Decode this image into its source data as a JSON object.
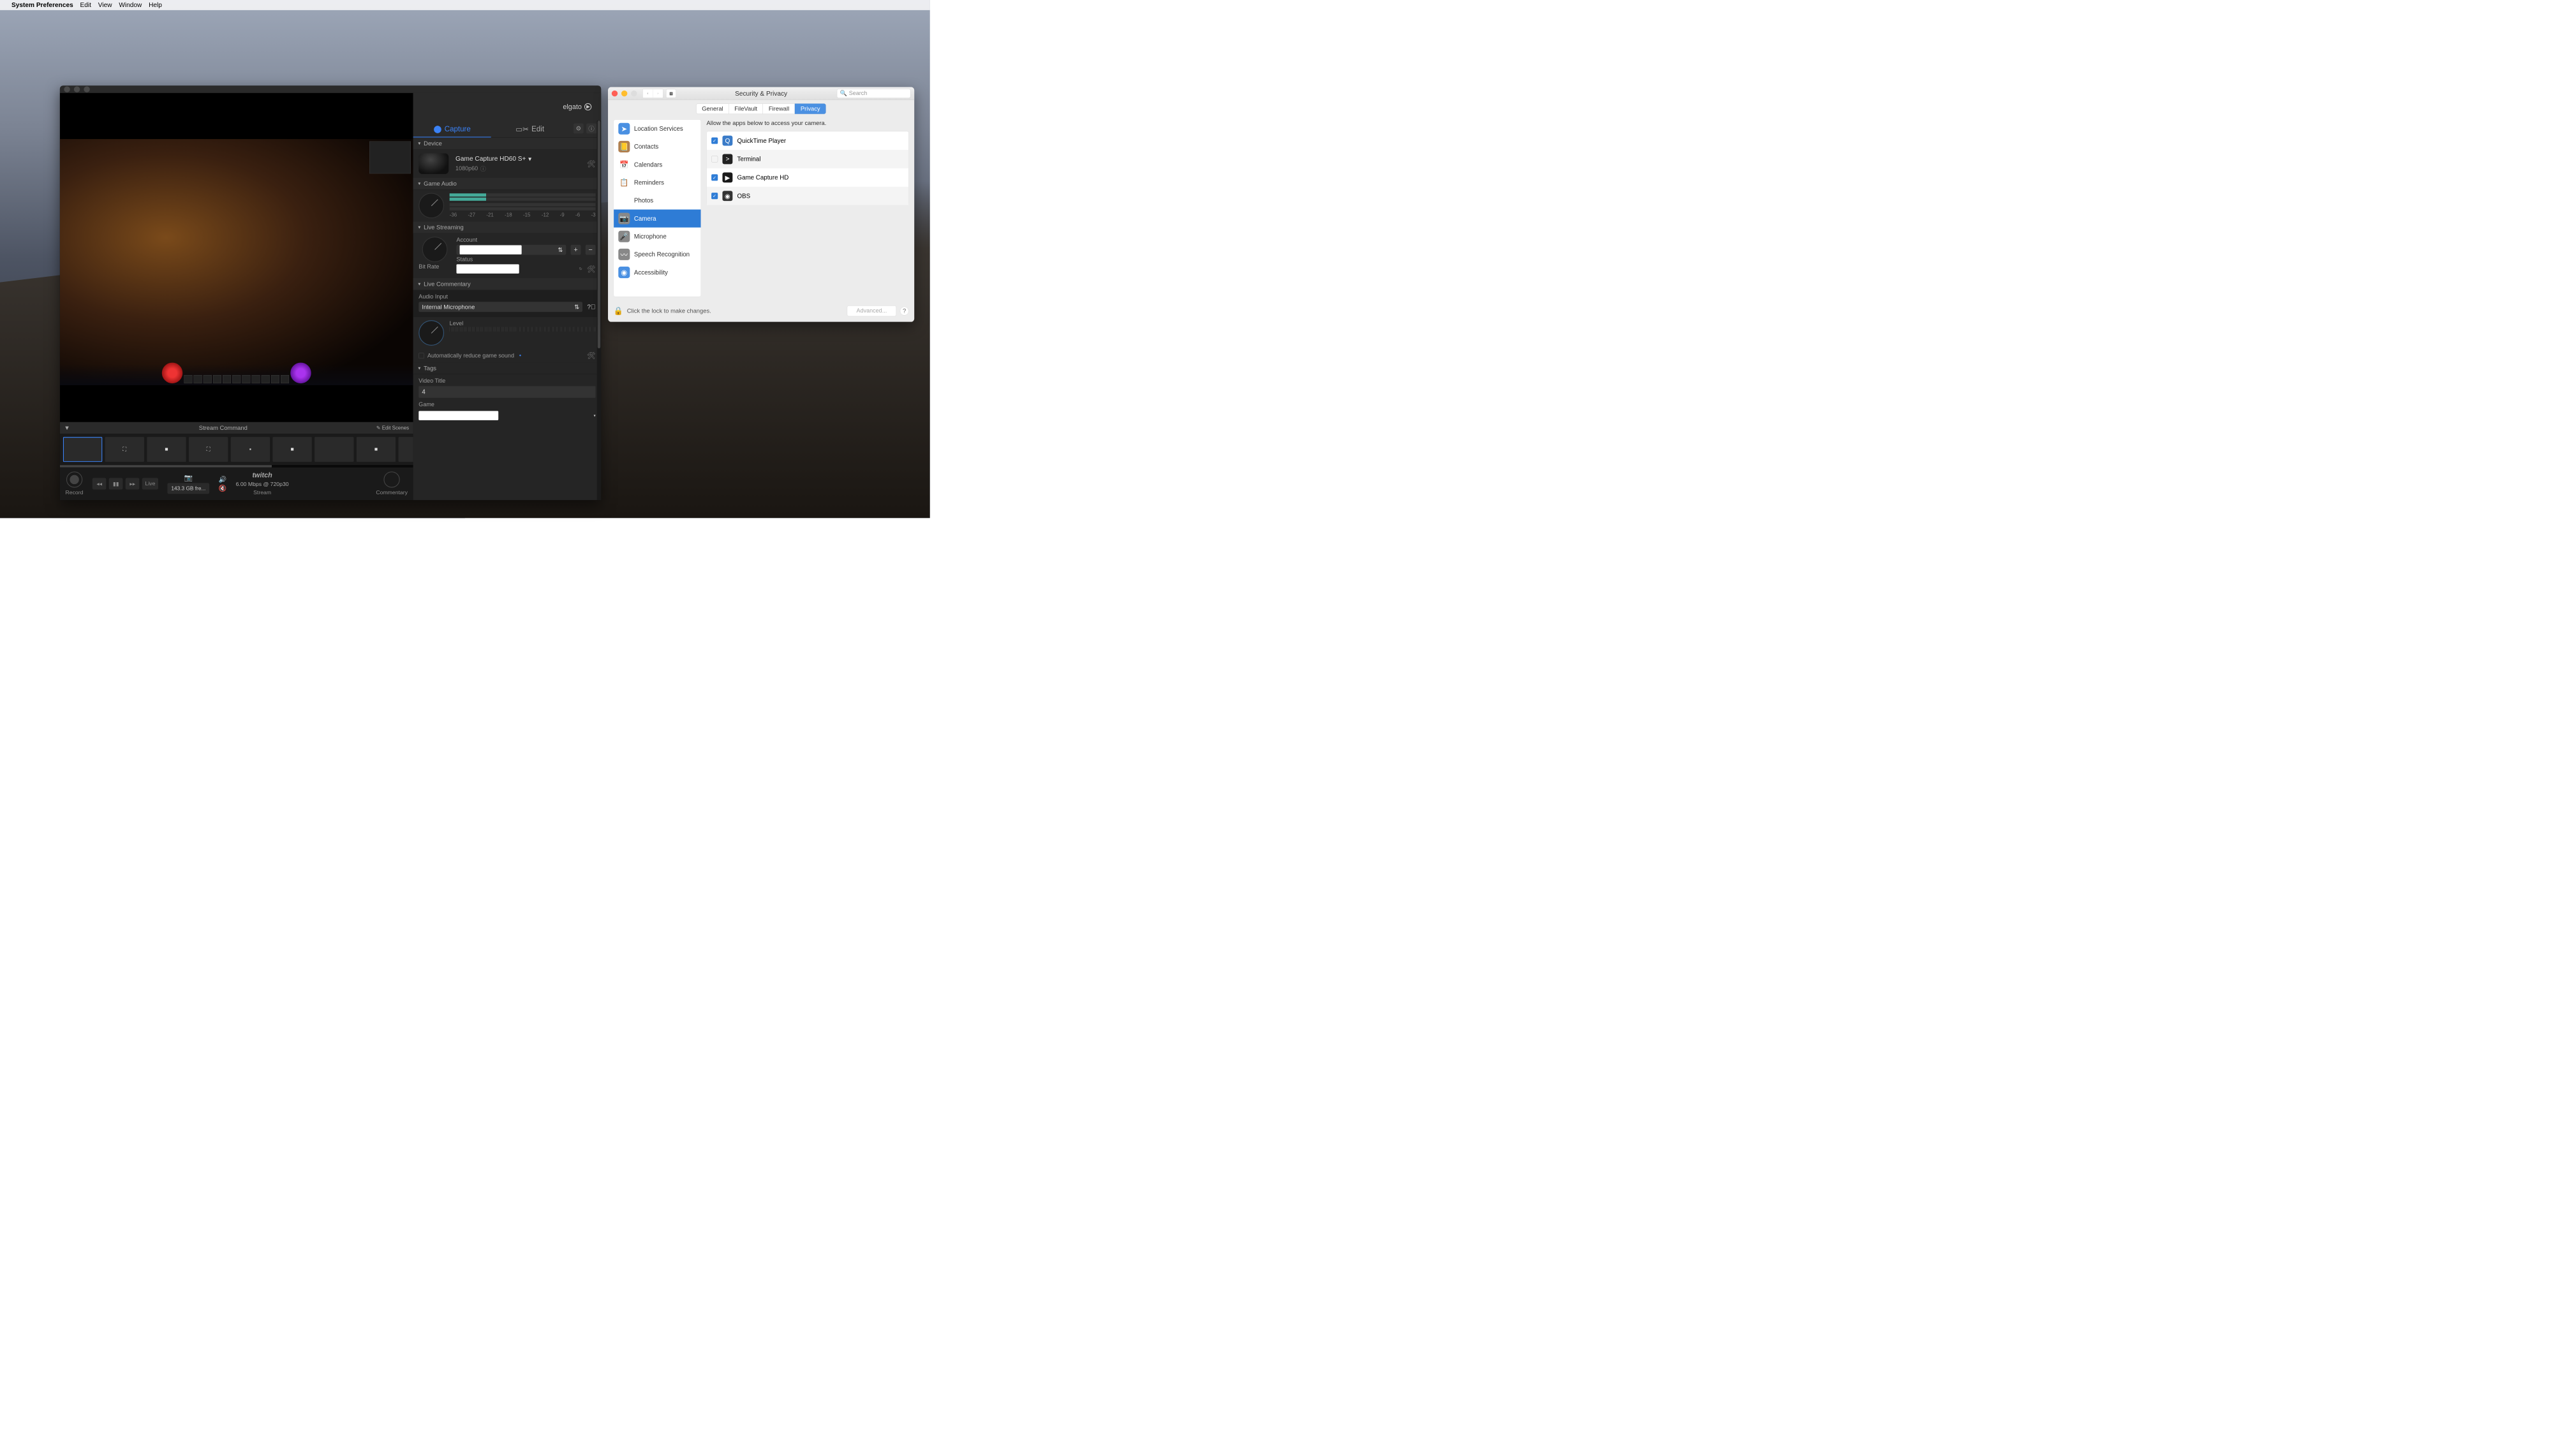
{
  "menubar": {
    "app_name": "System Preferences",
    "items": [
      "Edit",
      "View",
      "Window",
      "Help"
    ]
  },
  "elgato": {
    "brand": "elgato",
    "tabs": {
      "capture": "Capture",
      "edit": "Edit"
    },
    "sections": {
      "device": {
        "title": "Device",
        "name": "Game Capture HD60 S+",
        "res": "1080p60"
      },
      "game_audio": {
        "title": "Game Audio",
        "scale": [
          "-36",
          "-27",
          "-21",
          "-18",
          "-15",
          "-12",
          "-9",
          "-6",
          "-3"
        ]
      },
      "live_streaming": {
        "title": "Live Streaming",
        "account_label": "Account",
        "status_label": "Status",
        "bitrate_label": "Bit Rate"
      },
      "live_commentary": {
        "title": "Live Commentary",
        "audio_input_label": "Audio Input",
        "audio_input_value": "Internal Microphone",
        "level_label": "Level",
        "auto_reduce": "Automatically reduce game sound"
      },
      "tags": {
        "title": "Tags",
        "video_title_label": "Video Title",
        "video_title_value": "4",
        "game_label": "Game"
      }
    },
    "stream_command": {
      "title": "Stream Command",
      "edit_scenes": "Edit Scenes"
    },
    "bottom": {
      "record": "Record",
      "stream": "Stream",
      "commentary": "Commentary",
      "live": "Live",
      "storage": "143.3 GB fre...",
      "stream_info": "6.00 Mbps @ 720p30",
      "twitch": "twitch"
    }
  },
  "sysprefs": {
    "title": "Security & Privacy",
    "search_placeholder": "Search",
    "tabs": [
      "General",
      "FileVault",
      "Firewall",
      "Privacy"
    ],
    "active_tab": "Privacy",
    "sidebar": [
      {
        "label": "Location Services",
        "color": "#4a90e2",
        "glyph": "➤"
      },
      {
        "label": "Contacts",
        "color": "#b08050",
        "glyph": "📒"
      },
      {
        "label": "Calendars",
        "color": "#fff",
        "glyph": "📅"
      },
      {
        "label": "Reminders",
        "color": "#fff",
        "glyph": "📋"
      },
      {
        "label": "Photos",
        "color": "#fff",
        "glyph": "❋"
      },
      {
        "label": "Camera",
        "color": "#888",
        "glyph": "📷",
        "selected": true
      },
      {
        "label": "Microphone",
        "color": "#888",
        "glyph": "🎤"
      },
      {
        "label": "Speech Recognition",
        "color": "#888",
        "glyph": "〰"
      },
      {
        "label": "Accessibility",
        "color": "#4a90e2",
        "glyph": "◉"
      }
    ],
    "hint": "Allow the apps below to access your camera.",
    "apps": [
      {
        "name": "QuickTime Player",
        "checked": true,
        "bg": "#3a7bc8",
        "glyph": "Q"
      },
      {
        "name": "Terminal",
        "checked": false,
        "bg": "#222",
        "glyph": ">"
      },
      {
        "name": "Game Capture HD",
        "checked": true,
        "bg": "#1a1a1a",
        "glyph": "▶"
      },
      {
        "name": "OBS",
        "checked": true,
        "bg": "#333",
        "glyph": "◉"
      }
    ],
    "lock_text": "Click the lock to make changes.",
    "advanced": "Advanced...",
    "help": "?"
  }
}
